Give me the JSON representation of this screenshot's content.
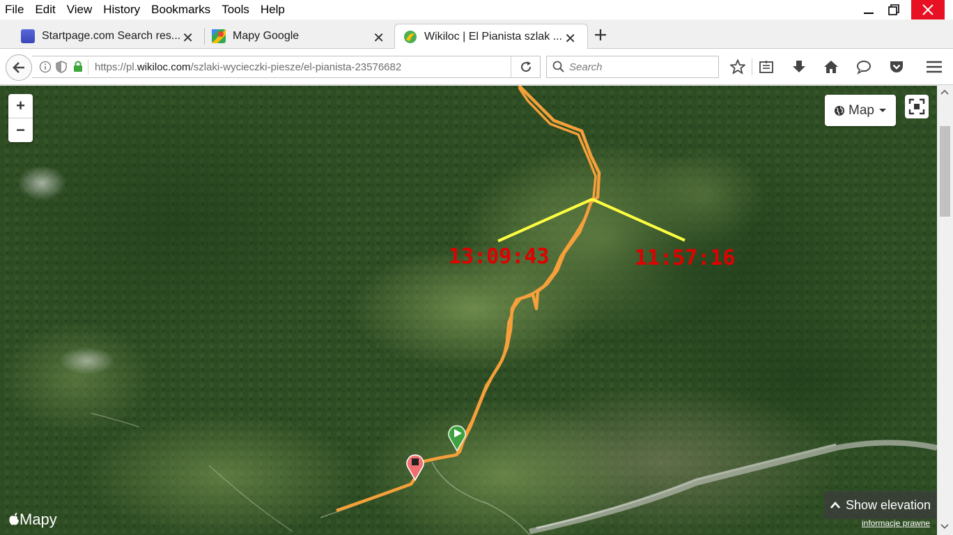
{
  "menubar": {
    "items": [
      "File",
      "Edit",
      "View",
      "History",
      "Bookmarks",
      "Tools",
      "Help"
    ]
  },
  "tabs": [
    {
      "title": "Startpage.com Search res...",
      "favicon": "startpage-icon",
      "active": false
    },
    {
      "title": "Mapy Google",
      "favicon": "google-maps-icon",
      "active": false
    },
    {
      "title": "Wikiloc | El Pianista szlak ...",
      "favicon": "wikiloc-icon",
      "active": true
    }
  ],
  "navbar": {
    "url_prefix": "https://pl.",
    "url_domain": "wikiloc.com",
    "url_path": "/szlaki-wycieczki-piesze/el-pianista-23576682",
    "search_placeholder": "Search"
  },
  "map": {
    "zoom_in": "+",
    "zoom_out": "−",
    "map_type_label": "Map",
    "time_left": "13:09:43",
    "time_right": "11:57:16",
    "show_elevation": "Show elevation",
    "legal": "informacje prawne",
    "logo": "Mapy",
    "colors": {
      "track": "#f5a03a",
      "annotation_line": "#ffff40",
      "annotation_text": "#e00000",
      "start_marker": "#4caf50",
      "end_marker": "#f07070"
    }
  }
}
